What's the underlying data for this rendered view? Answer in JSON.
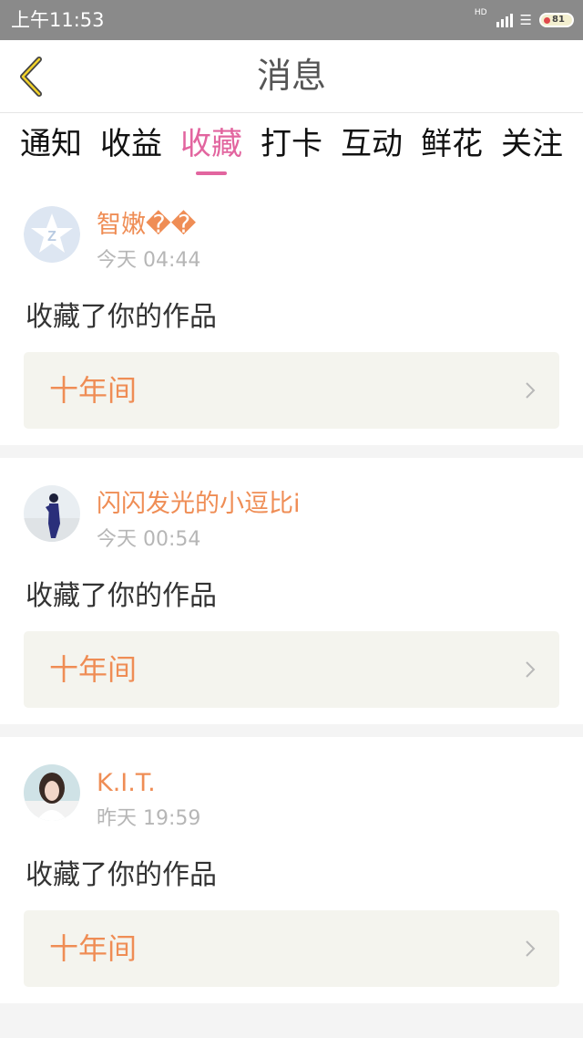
{
  "status_bar": {
    "time": "上午11:53",
    "network": "HD",
    "battery": "81"
  },
  "header": {
    "title": "消息"
  },
  "tabs": [
    {
      "label": "通知",
      "active": false
    },
    {
      "label": "收益",
      "active": false
    },
    {
      "label": "收藏",
      "active": true
    },
    {
      "label": "打卡",
      "active": false
    },
    {
      "label": "互动",
      "active": false
    },
    {
      "label": "鲜花",
      "active": false
    },
    {
      "label": "关注",
      "active": false
    }
  ],
  "colors": {
    "accent": "#e2659f",
    "username": "#ef8d55",
    "work": "#ef8d55"
  },
  "notifications": [
    {
      "user": "智嫩��",
      "time": "今天 04:44",
      "action": "收藏了你的作品",
      "work": "十年间",
      "avatar_icon": "qzone-star-icon"
    },
    {
      "user": "闪闪发光的小逗比i",
      "time": "今天 00:54",
      "action": "收藏了你的作品",
      "work": "十年间",
      "avatar_icon": "photo-avatar"
    },
    {
      "user": "K.I.T.",
      "time": "昨天 19:59",
      "action": "收藏了你的作品",
      "work": "十年间",
      "avatar_icon": "photo-avatar"
    }
  ]
}
